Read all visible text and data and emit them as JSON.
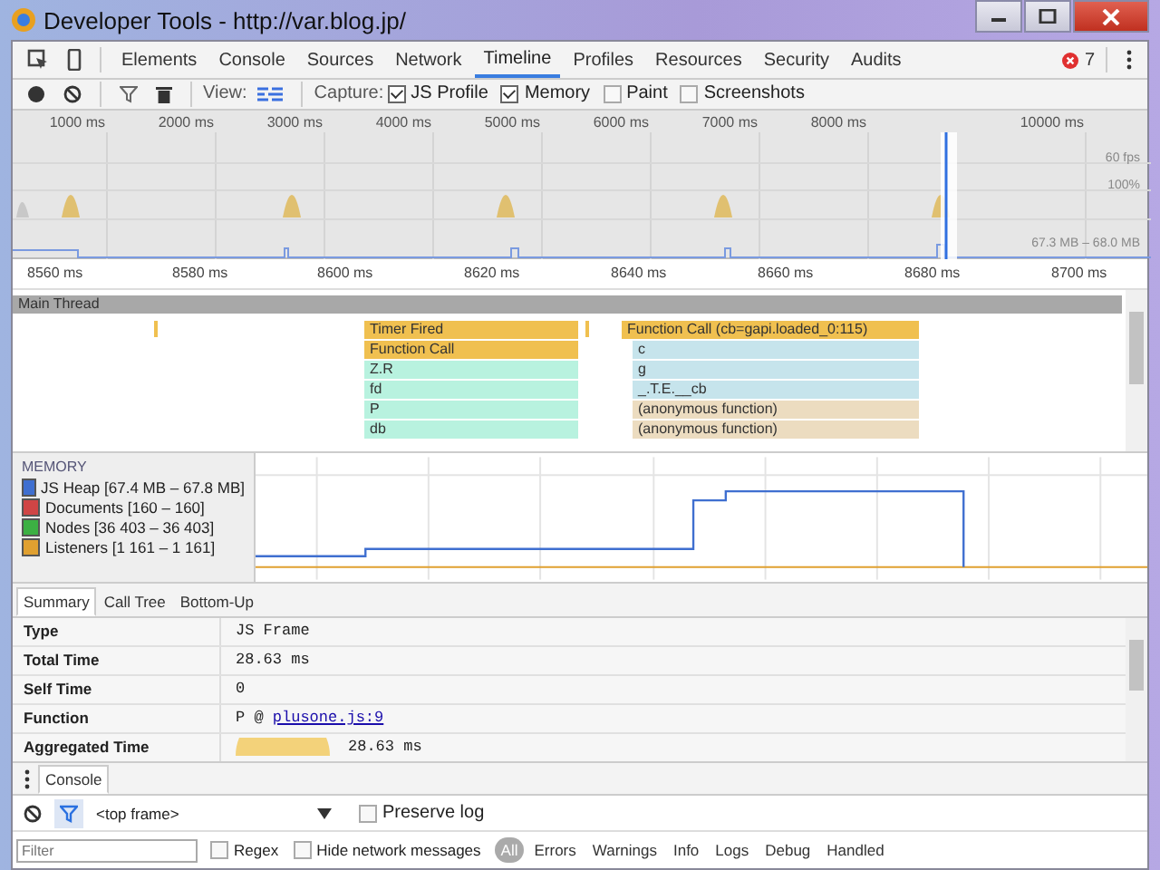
{
  "window": {
    "title": "Developer Tools - http://var.blog.jp/"
  },
  "tabs": [
    {
      "label": "Elements",
      "selected": false
    },
    {
      "label": "Console",
      "selected": false
    },
    {
      "label": "Sources",
      "selected": false
    },
    {
      "label": "Network",
      "selected": false
    },
    {
      "label": "Timeline",
      "selected": true
    },
    {
      "label": "Profiles",
      "selected": false
    },
    {
      "label": "Resources",
      "selected": false
    },
    {
      "label": "Security",
      "selected": false
    },
    {
      "label": "Audits",
      "selected": false
    }
  ],
  "error_count": "7",
  "toolbar": {
    "view_label": "View:",
    "capture_label": "Capture:",
    "options": [
      {
        "label": "JS Profile",
        "checked": true
      },
      {
        "label": "Memory",
        "checked": true
      },
      {
        "label": "Paint",
        "checked": false
      },
      {
        "label": "Screenshots",
        "checked": false
      }
    ]
  },
  "overview": {
    "ticks": [
      "1000 ms",
      "2000 ms",
      "3000 ms",
      "4000 ms",
      "5000 ms",
      "6000 ms",
      "7000 ms",
      "8000 ms",
      "10000 ms"
    ],
    "fps_label": "60 fps",
    "cpu_label": "100%",
    "memory_range": "67.3 MB – 68.0 MB"
  },
  "ruler": [
    "8560 ms",
    "8580 ms",
    "8600 ms",
    "8620 ms",
    "8640 ms",
    "8660 ms",
    "8680 ms",
    "8700 ms"
  ],
  "flame_chart": {
    "thread": "Main Thread",
    "stacks": [
      {
        "bars": [
          {
            "label": "Timer Fired",
            "kind": "event"
          },
          {
            "label": "Function Call",
            "kind": "event"
          },
          {
            "label": "Z.R",
            "kind": "script"
          },
          {
            "label": "fd",
            "kind": "script"
          },
          {
            "label": "P",
            "kind": "script"
          },
          {
            "label": "db",
            "kind": "script"
          }
        ]
      },
      {
        "bars": [
          {
            "label": "Function Call (cb=gapi.loaded_0:115)",
            "kind": "event"
          },
          {
            "label": "c",
            "kind": "library"
          },
          {
            "label": "g",
            "kind": "library"
          },
          {
            "label": "_.T.E.__cb",
            "kind": "library"
          },
          {
            "label": "(anonymous function)",
            "kind": "anonymous"
          },
          {
            "label": "(anonymous function)",
            "kind": "anonymous"
          }
        ]
      }
    ]
  },
  "memory": {
    "title": "MEMORY",
    "counters": [
      {
        "label": "JS Heap [67.4 MB – 67.8 MB]",
        "checked": true,
        "color": "#3f6fd0"
      },
      {
        "label": "Documents [160 – 160]",
        "checked": true,
        "color": "#d04545"
      },
      {
        "label": "Nodes [36 403 – 36 403]",
        "checked": true,
        "color": "#3cb043"
      },
      {
        "label": "Listeners [1 161 – 1 161]",
        "checked": true,
        "color": "#e0a030"
      }
    ]
  },
  "details": {
    "tabs": [
      {
        "label": "Summary",
        "selected": true
      },
      {
        "label": "Call Tree",
        "selected": false
      },
      {
        "label": "Bottom-Up",
        "selected": false
      }
    ],
    "rows": [
      {
        "label": "Type",
        "value": "JS Frame"
      },
      {
        "label": "Total Time",
        "value": "28.63 ms"
      },
      {
        "label": "Self Time",
        "value": "0"
      },
      {
        "label": "Function",
        "value": "P @ ",
        "link": "plusone.js:9"
      },
      {
        "label": "Aggregated Time",
        "value": "28.63 ms",
        "kind": "pie"
      }
    ]
  },
  "drawer": {
    "tabs": [
      {
        "label": "Console",
        "selected": true
      }
    ],
    "context": "<top frame>",
    "preserve_log": {
      "label": "Preserve log",
      "checked": false
    },
    "filter": {
      "placeholder": "Filter"
    },
    "regex": {
      "label": "Regex",
      "checked": false
    },
    "hide_network": {
      "label": "Hide network messages",
      "checked": false
    },
    "levels": [
      {
        "label": "All",
        "selected": true
      },
      {
        "label": "Errors",
        "selected": false
      },
      {
        "label": "Warnings",
        "selected": false
      },
      {
        "label": "Info",
        "selected": false
      },
      {
        "label": "Logs",
        "selected": false
      },
      {
        "label": "Debug",
        "selected": false
      },
      {
        "label": "Handled",
        "selected": false
      }
    ]
  }
}
